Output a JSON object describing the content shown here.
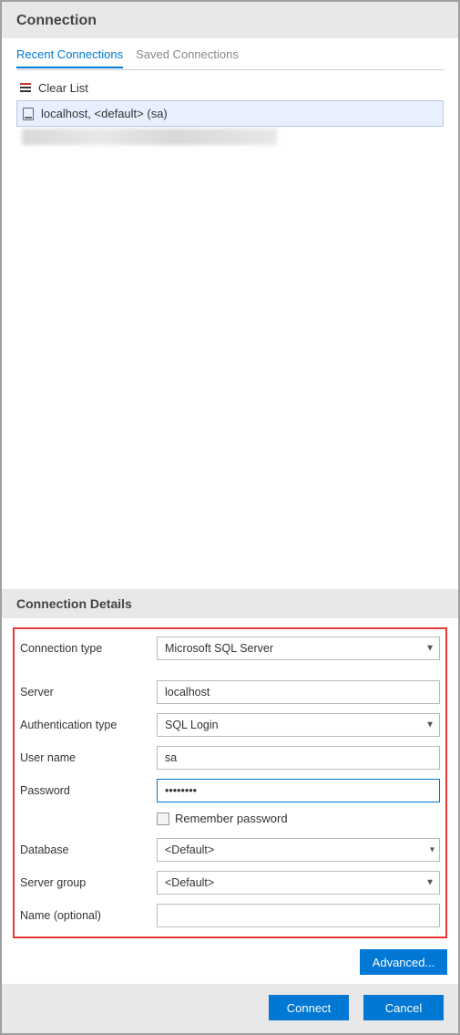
{
  "header": {
    "title": "Connection"
  },
  "tabs": {
    "recent": "Recent Connections",
    "saved": "Saved Connections"
  },
  "list": {
    "clear_label": "Clear List",
    "items": [
      {
        "label": "localhost, <default> (sa)"
      }
    ]
  },
  "details": {
    "heading": "Connection Details",
    "connection_type_label": "Connection type",
    "connection_type_value": "Microsoft SQL Server",
    "server_label": "Server",
    "server_value": "localhost",
    "auth_type_label": "Authentication type",
    "auth_type_value": "SQL Login",
    "username_label": "User name",
    "username_value": "sa",
    "password_label": "Password",
    "password_value": "••••••••",
    "remember_label": "Remember password",
    "database_label": "Database",
    "database_value": "<Default>",
    "server_group_label": "Server group",
    "server_group_value": "<Default>",
    "name_label": "Name (optional)",
    "name_value": ""
  },
  "buttons": {
    "advanced": "Advanced...",
    "connect": "Connect",
    "cancel": "Cancel"
  }
}
